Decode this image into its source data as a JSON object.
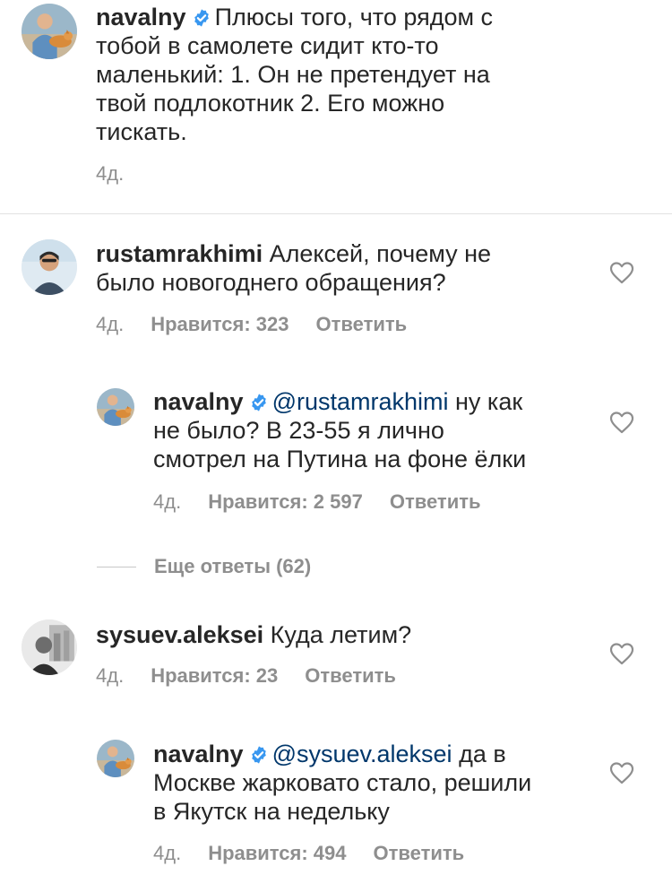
{
  "caption": {
    "username": "navalny",
    "text_lines": [
      "Плюсы того, что рядом с",
      "тобой в самолете сидит кто-то",
      "маленький: 1. Он не претендует на",
      "твой подлокотник 2. Его можно",
      "тискать."
    ],
    "time": "4д."
  },
  "comments": [
    {
      "username": "rustamrakhimi",
      "text_lines": [
        "Алексей, почему не",
        "было новогоднего обращения?"
      ],
      "time": "4д.",
      "likes": "Нравится: 323",
      "reply": "Ответить"
    },
    {
      "username": "navalny",
      "mention": "@rustamrakhimi",
      "text_lines": [
        "ну как",
        "не было? В 23-55 я лично",
        "смотрел на Путина на фоне ёлки"
      ],
      "time": "4д.",
      "likes": "Нравится: 2 597",
      "reply": "Ответить"
    },
    {
      "username": "sysuev.aleksei",
      "text_lines": [
        "Куда летим?"
      ],
      "time": "4д.",
      "likes": "Нравится: 23",
      "reply": "Ответить"
    },
    {
      "username": "navalny",
      "mention": "@sysuev.aleksei",
      "text_lines": [
        "да в",
        "Москве жарковато стало, решили",
        "в Якутск на недельку"
      ],
      "time": "4д.",
      "likes": "Нравится: 494",
      "reply": "Ответить"
    }
  ],
  "view_more": "Еще ответы (62)",
  "icons": {
    "verified": "verified-badge-icon",
    "like": "heart-icon"
  },
  "colors": {
    "text": "#262626",
    "meta": "#8e8e8e",
    "mention": "#00376b",
    "verified": "#3897f0",
    "separator": "#e2e2e2"
  }
}
